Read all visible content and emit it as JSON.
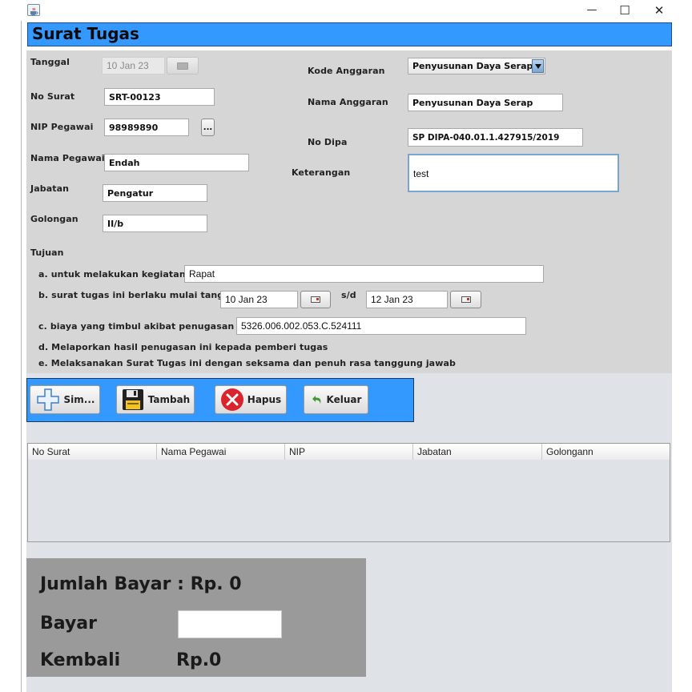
{
  "window": {
    "app_icon": "java-cup-icon",
    "minimize_glyph": "—",
    "maximize_glyph": "☐",
    "close_glyph": "✕"
  },
  "header": {
    "title": "Surat Tugas",
    "accent": "#3399ff"
  },
  "form": {
    "tanggal_label": "Tanggal",
    "tanggal_value": "10 Jan 23",
    "no_surat_label": "No Surat",
    "no_surat_value": "SRT-00123",
    "nip_label": "NIP Pegawai",
    "nip_value": "98989890",
    "nip_browse_label": "...",
    "nama_label": "Nama Pegawai",
    "nama_value": "Endah",
    "jabatan_label": "Jabatan",
    "jabatan_value": "Pengatur",
    "golongan_label": "Golongan",
    "golongan_value": "II/b",
    "kode_anggaran_label": "Kode Anggaran",
    "kode_anggaran_value": "Penyusunan Daya Serap",
    "nama_anggaran_label": "Nama Anggaran",
    "nama_anggaran_value": "Penyusunan Daya Serap",
    "no_dipa_label": "No Dipa",
    "no_dipa_value": "SP DIPA-040.01.1.427915/2019",
    "keterangan_label": "Keterangan",
    "keterangan_value": "test"
  },
  "tujuan": {
    "heading": "Tujuan",
    "a_label": "a. untuk melakukan kegiatan :",
    "a_value": "Rapat",
    "b_label": "b. surat tugas ini berlaku mulai tanggal :",
    "b_from": "10 Jan 23",
    "b_sd": "s/d",
    "b_to": "12 Jan 23",
    "c_label": "c. biaya yang timbul akibat penugasan ini :",
    "c_value": "5326.006.002.053.C.524111",
    "d_text": "d. Melaporkan hasil penugasan ini kepada pemberi tugas",
    "e_text": "e. Melaksanakan Surat Tugas ini dengan seksama dan penuh rasa tanggung jawab"
  },
  "toolbar": {
    "simpan_label": "Sim...",
    "tambah_label": "Tambah",
    "hapus_label": "Hapus",
    "keluar_label": "Keluar"
  },
  "table": {
    "columns": [
      "No Surat",
      "Nama Pegawai",
      "NIP",
      "Jabatan",
      "Golongann"
    ],
    "rows": []
  },
  "payment": {
    "jumlah_bayar": "Jumlah Bayar : Rp. 0",
    "bayar_label": "Bayar",
    "bayar_value": "",
    "kembali_label": "Kembali",
    "kembali_value": "Rp.0"
  }
}
